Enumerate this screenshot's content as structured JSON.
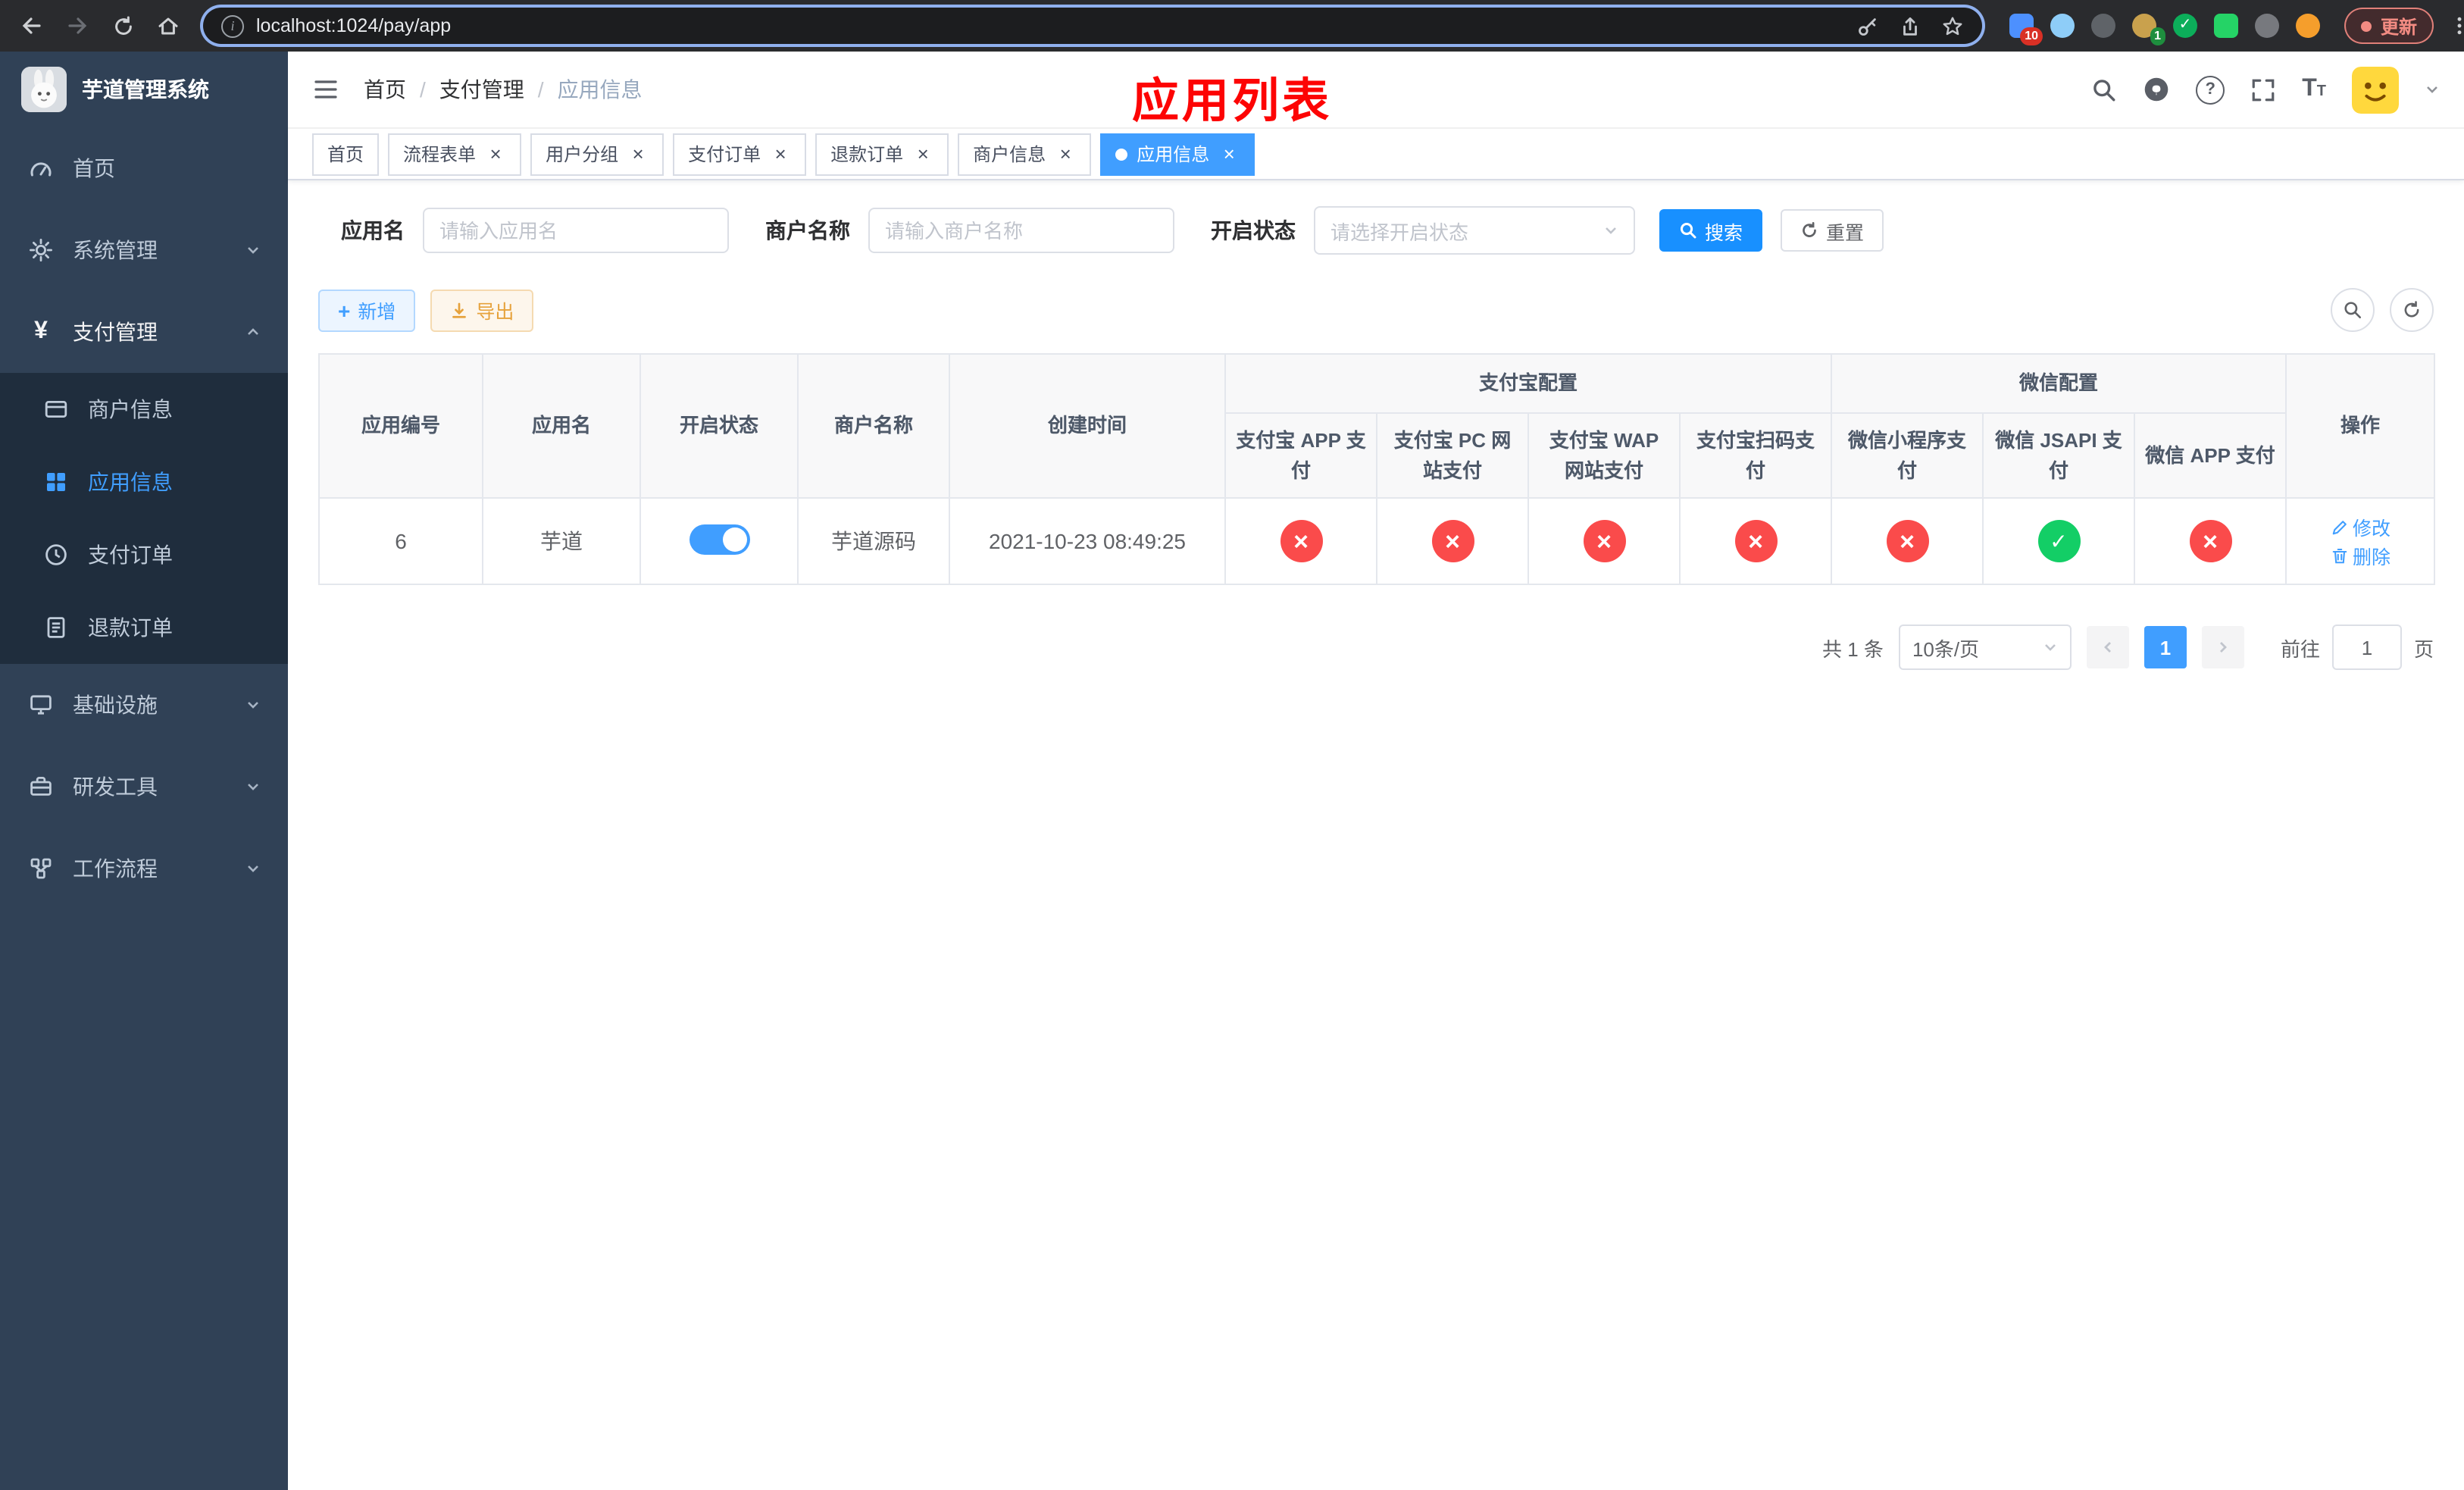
{
  "browser": {
    "url": "localhost:1024/pay/app",
    "update_label": "更新",
    "ext_badge_blue": "10",
    "ext_badge_avatar": "1"
  },
  "sidebar": {
    "title": "芋道管理系统",
    "items": [
      {
        "label": "首页"
      },
      {
        "label": "系统管理"
      },
      {
        "label": "支付管理"
      },
      {
        "label": "商户信息"
      },
      {
        "label": "应用信息"
      },
      {
        "label": "支付订单"
      },
      {
        "label": "退款订单"
      },
      {
        "label": "基础设施"
      },
      {
        "label": "研发工具"
      },
      {
        "label": "工作流程"
      }
    ]
  },
  "header": {
    "breadcrumb": [
      "首页",
      "支付管理",
      "应用信息"
    ],
    "separator": "/",
    "annotation": "应用列表"
  },
  "tabs": [
    {
      "label": "首页"
    },
    {
      "label": "流程表单"
    },
    {
      "label": "用户分组"
    },
    {
      "label": "支付订单"
    },
    {
      "label": "退款订单"
    },
    {
      "label": "商户信息"
    },
    {
      "label": "应用信息"
    }
  ],
  "filters": {
    "app_name_label": "应用名",
    "app_name_placeholder": "请输入应用名",
    "merchant_label": "商户名称",
    "merchant_placeholder": "请输入商户名称",
    "status_label": "开启状态",
    "status_placeholder": "请选择开启状态",
    "search_button": "搜索",
    "reset_button": "重置"
  },
  "toolbar": {
    "add_button": "新增",
    "export_button": "导出"
  },
  "table": {
    "columns": {
      "id": "应用编号",
      "name": "应用名",
      "enabled": "开启状态",
      "merchant": "商户名称",
      "created": "创建时间",
      "alipay_group": "支付宝配置",
      "wechat_group": "微信配置",
      "alipay_app": "支付宝 APP 支付",
      "alipay_pc": "支付宝 PC 网站支付",
      "alipay_wap": "支付宝 WAP 网站支付",
      "alipay_qr": "支付宝扫码支付",
      "wechat_mini": "微信小程序支付",
      "wechat_jsapi": "微信 JSAPI 支付",
      "wechat_app": "微信 APP 支付",
      "actions": "操作"
    },
    "row": {
      "id": "6",
      "name": "芋道",
      "enabled": true,
      "merchant": "芋道源码",
      "created": "2021-10-23 08:49:25",
      "statuses": [
        "no",
        "no",
        "no",
        "no",
        "no",
        "yes",
        "no"
      ],
      "edit_label": "修改",
      "delete_label": "删除"
    }
  },
  "pagination": {
    "total": "共 1 条",
    "page_size": "10条/页",
    "current_page": "1",
    "goto_label": "前往",
    "goto_value": "1",
    "page_unit": "页"
  },
  "icons": [
    "back-icon",
    "forward-icon",
    "reload-icon",
    "home-icon",
    "site-info-icon",
    "password-key-icon",
    "share-icon",
    "bookmark-star-icon",
    "extension-icons",
    "kebab-menu-icon",
    "bunny-logo",
    "dashboard-icon",
    "gear-icon",
    "yen-icon",
    "merchant-card-icon",
    "app-grid-icon",
    "order-icon",
    "refund-doc-icon",
    "infra-icon",
    "tools-icon",
    "workflow-icon",
    "chevron-down-icon",
    "chevron-up-icon",
    "collapse-menu-icon",
    "search-icon",
    "github-icon",
    "help-icon",
    "fullscreen-icon",
    "font-size-icon",
    "caret-down-icon",
    "close-icon",
    "magnifier-icon",
    "refresh-icon",
    "plus-icon",
    "download-icon",
    "toggle-switch",
    "cross-icon",
    "check-icon",
    "edit-icon",
    "delete-icon",
    "prev-icon",
    "next-icon"
  ],
  "colors": {
    "primary": "#409EFF",
    "search_button": "#1890ff",
    "danger_circle": "#fa4b4b",
    "success_circle": "#13ce66",
    "warning_text": "#e6a23c",
    "sidebar_bg": "#304156",
    "submenu_bg": "#1f2d3d",
    "annotation_red": "#fd0404",
    "update_chip": "#f28b82"
  }
}
